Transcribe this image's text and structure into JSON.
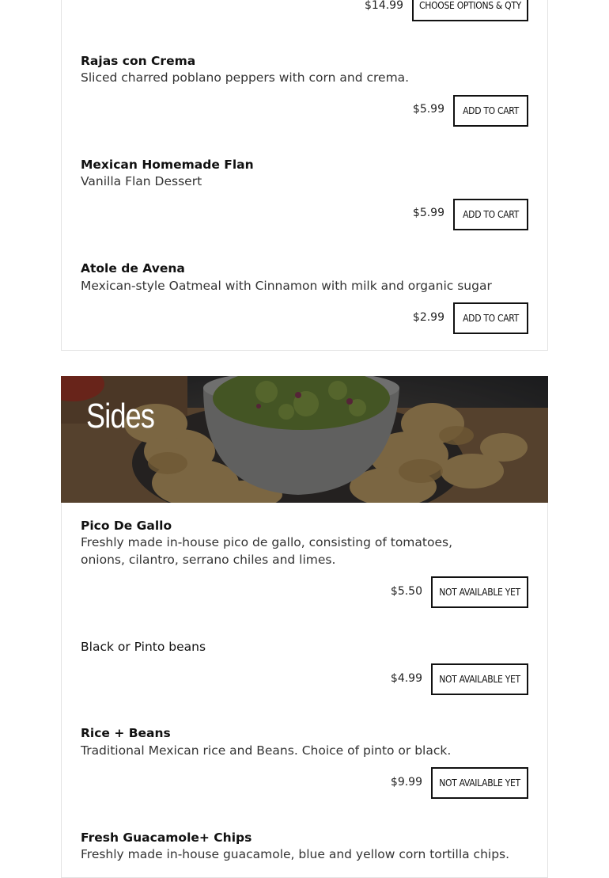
{
  "top_item": {
    "price": "$14.99",
    "button": "CHOOSE OPTIONS & QTY"
  },
  "menu_items": [
    {
      "name": "Rajas con Crema",
      "desc": "Sliced charred poblano peppers with corn and crema.",
      "price": "$5.99",
      "button": "ADD TO CART"
    },
    {
      "name": "Mexican Homemade Flan",
      "desc": "Vanilla Flan Dessert",
      "price": "$5.99",
      "button": "ADD TO CART"
    },
    {
      "name": "Atole de Avena",
      "desc": "Mexican-style Oatmeal with Cinnamon with milk and organic sugar",
      "price": "$2.99",
      "button": "ADD TO CART"
    }
  ],
  "sides": {
    "title": "Sides",
    "items": [
      {
        "name": "Pico De Gallo",
        "desc": "Freshly made in-house pico de gallo, consisting of tomatoes, onions, cilantro, serrano chiles and limes.",
        "price": "$5.50",
        "button": "NOT AVAILABLE YET"
      },
      {
        "name": "Black or Pinto beans",
        "desc": "",
        "price": "$4.99",
        "button": "NOT AVAILABLE YET"
      },
      {
        "name": "Rice + Beans",
        "desc": "Traditional Mexican rice and Beans. Choice of pinto or black.",
        "price": "$9.99",
        "button": "NOT AVAILABLE YET"
      },
      {
        "name": "Fresh Guacamole+ Chips",
        "desc": "Freshly made in-house guacamole, blue and yellow corn tortilla chips."
      }
    ]
  }
}
